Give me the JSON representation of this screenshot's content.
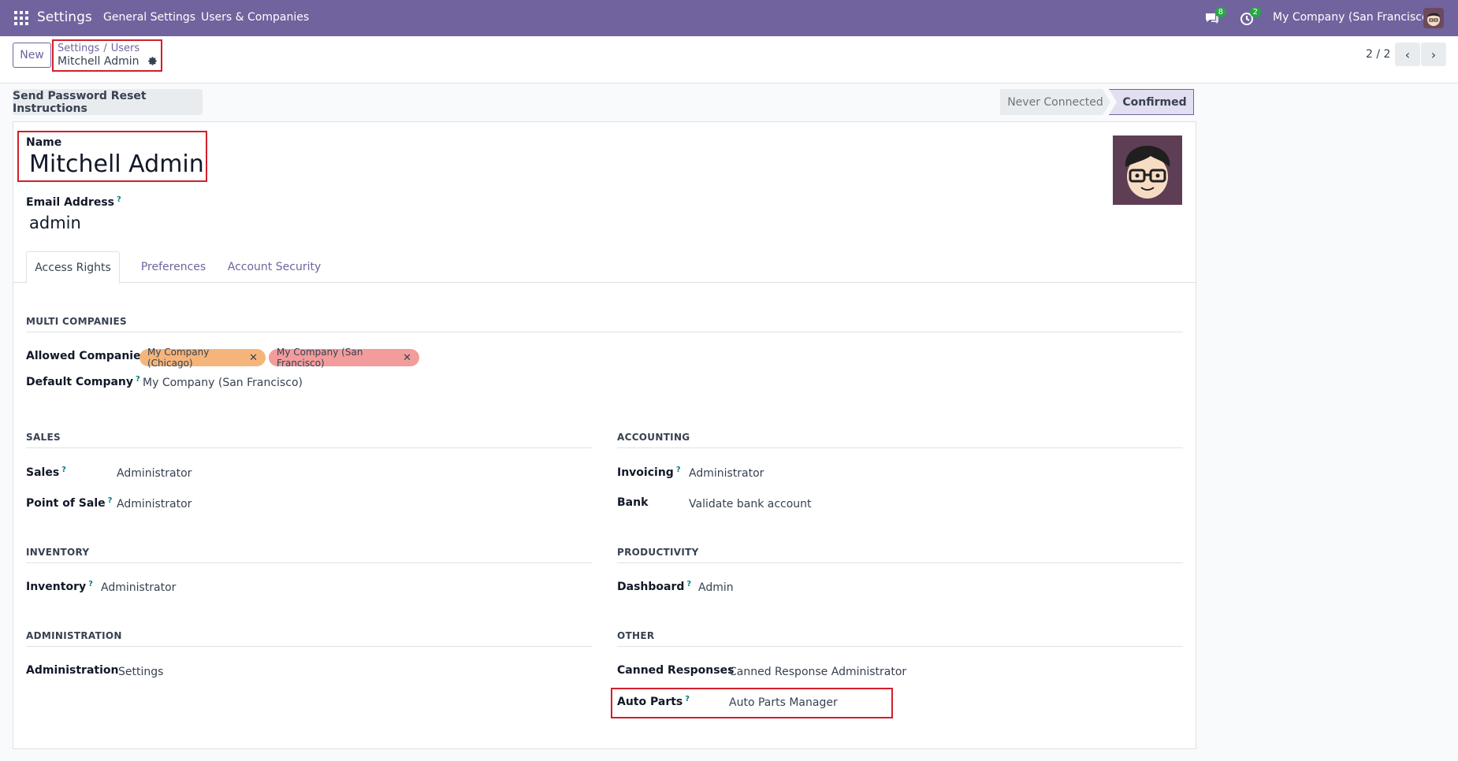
{
  "navbar": {
    "brand": "Settings",
    "menu": [
      "General Settings",
      "Users & Companies"
    ],
    "messages_count": "8",
    "activities_count": "2",
    "company": "My Company (San Francisco)"
  },
  "control_panel": {
    "new_label": "New",
    "breadcrumb": [
      "Settings",
      "Users"
    ],
    "breadcrumb_sep": "/",
    "record_title": "Mitchell Admin",
    "pager": "2 / 2"
  },
  "statusbar": {
    "action_button": "Send Password Reset Instructions",
    "stages": [
      "Never Connected",
      "Confirmed"
    ],
    "active_stage": "Confirmed"
  },
  "form": {
    "name_label": "Name",
    "name_value": "Mitchell Admin",
    "email_label": "Email Address",
    "email_value": "admin",
    "help_mark": "?"
  },
  "tabs": [
    "Access Rights",
    "Preferences",
    "Account Security"
  ],
  "multi_companies": {
    "title": "MULTI COMPANIES",
    "allowed_label": "Allowed Companies",
    "allowed_tags": [
      "My Company (Chicago)",
      "My Company (San Francisco)"
    ],
    "default_label": "Default Company",
    "default_value": "My Company (San Francisco)"
  },
  "sales": {
    "title": "SALES",
    "fields": [
      {
        "label": "Sales",
        "value": "Administrator"
      },
      {
        "label": "Point of Sale",
        "value": "Administrator"
      }
    ]
  },
  "accounting": {
    "title": "ACCOUNTING",
    "fields": [
      {
        "label": "Invoicing",
        "value": "Administrator"
      },
      {
        "label": "Bank",
        "value": "Validate bank account"
      }
    ]
  },
  "inventory": {
    "title": "INVENTORY",
    "fields": [
      {
        "label": "Inventory",
        "value": "Administrator"
      }
    ]
  },
  "productivity": {
    "title": "PRODUCTIVITY",
    "fields": [
      {
        "label": "Dashboard",
        "value": "Admin"
      }
    ]
  },
  "administration": {
    "title": "ADMINISTRATION",
    "fields": [
      {
        "label": "Administration",
        "value": "Settings"
      }
    ]
  },
  "other": {
    "title": "OTHER",
    "fields": [
      {
        "label": "Canned Responses",
        "value": "Canned Response Administrator"
      },
      {
        "label": "Auto Parts",
        "value": "Auto Parts Manager"
      }
    ]
  },
  "colors": {
    "navbar": "#71639e",
    "highlight": "#d11f2a",
    "tag_chicago": "#f5b57a",
    "tag_sf": "#f29c9c"
  }
}
